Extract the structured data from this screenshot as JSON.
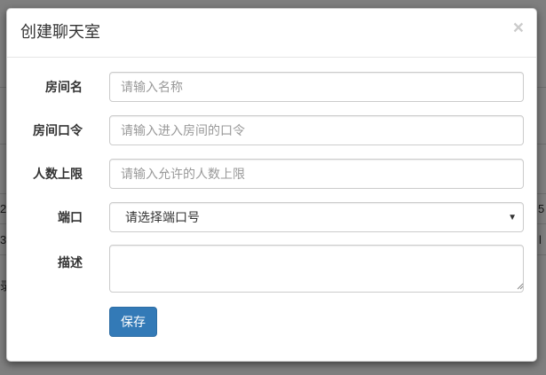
{
  "background": {
    "fragments": [
      "2",
      "3",
      "5",
      "l",
      "录"
    ]
  },
  "modal": {
    "title": "创建聊天室",
    "close_symbol": "×",
    "fields": {
      "room_name": {
        "label": "房间名",
        "placeholder": "请输入名称"
      },
      "room_password": {
        "label": "房间口令",
        "placeholder": "请输入进入房间的口令"
      },
      "max_users": {
        "label": "人数上限",
        "placeholder": "请输入允许的人数上限"
      },
      "port": {
        "label": "端口",
        "selected": "请选择端口号",
        "caret": "▼"
      },
      "description": {
        "label": "描述",
        "placeholder": ""
      }
    },
    "save_label": "保存"
  }
}
